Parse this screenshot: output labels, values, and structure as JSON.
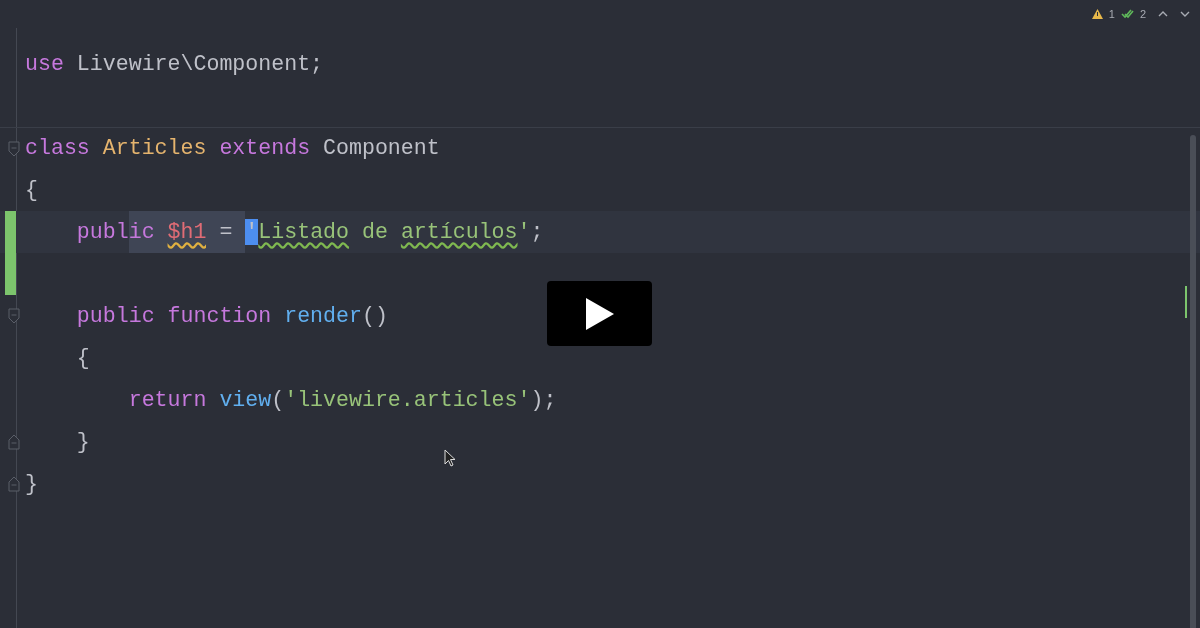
{
  "inspections": {
    "warnings": "1",
    "passed": "2"
  },
  "lines": [
    {
      "changed": false,
      "current": false,
      "tokens": [
        {
          "kind": "keyword",
          "text": "use",
          "selected": false
        },
        {
          "kind": "plain",
          "text": " Livewire\\Component;",
          "selected": false
        }
      ]
    },
    {
      "changed": false,
      "current": false
    },
    {
      "fold_start": true,
      "changed": false,
      "current": false,
      "tokens": [
        {
          "kind": "keyword",
          "text": "class",
          "selected": false
        },
        {
          "kind": "class",
          "text": " Articles ",
          "selected": false
        },
        {
          "kind": "keyword",
          "text": "extends",
          "selected": false
        },
        {
          "kind": "plain",
          "text": " Component",
          "selected": false
        }
      ]
    },
    {
      "changed": false,
      "current": false,
      "tokens": [
        {
          "kind": "plain",
          "text": "{",
          "selected": false
        }
      ]
    },
    {
      "changed": true,
      "current": true,
      "tokens": [
        {
          "kind": "keyword",
          "text": "    publ",
          "selected": false
        },
        {
          "kind": "keyword",
          "text": "ic ",
          "selected": true
        },
        {
          "kind": "variable",
          "text": "$h1",
          "selected": true,
          "warning": true
        },
        {
          "kind": "plain",
          "text": " = ",
          "selected": true
        },
        {
          "kind": "caret",
          "text": "'",
          "selected": false
        },
        {
          "kind": "string",
          "text": "Listado",
          "selected": false,
          "misspelled": true
        },
        {
          "kind": "string",
          "text": " de ",
          "selected": false
        },
        {
          "kind": "string",
          "text": "artículos",
          "selected": false,
          "misspelled": true
        },
        {
          "kind": "string",
          "text": "'",
          "selected": false
        },
        {
          "kind": "plain",
          "text": ";",
          "selected": false
        }
      ]
    },
    {
      "changed": true,
      "current": false
    },
    {
      "fold_start": true,
      "changed": false,
      "current": false,
      "tokens": [
        {
          "kind": "keyword",
          "text": "    public function ",
          "selected": false
        },
        {
          "kind": "function",
          "text": "render",
          "selected": false
        },
        {
          "kind": "plain",
          "text": "()",
          "selected": false
        }
      ]
    },
    {
      "changed": false,
      "current": false,
      "tokens": [
        {
          "kind": "plain",
          "text": "    {",
          "selected": false
        }
      ]
    },
    {
      "changed": false,
      "current": false,
      "tokens": [
        {
          "kind": "keyword",
          "text": "        return ",
          "selected": false
        },
        {
          "kind": "function",
          "text": "view",
          "selected": false
        },
        {
          "kind": "plain",
          "text": "(",
          "selected": false
        },
        {
          "kind": "string",
          "text": "'livewire.articles'",
          "selected": false
        },
        {
          "kind": "plain",
          "text": ");",
          "selected": false
        }
      ]
    },
    {
      "fold_end": true,
      "changed": false,
      "current": false,
      "tokens": [
        {
          "kind": "plain",
          "text": "    }",
          "selected": false
        }
      ]
    },
    {
      "fold_end": true,
      "changed": false,
      "current": false,
      "tokens": [
        {
          "kind": "plain",
          "text": "}",
          "selected": false
        }
      ]
    }
  ]
}
